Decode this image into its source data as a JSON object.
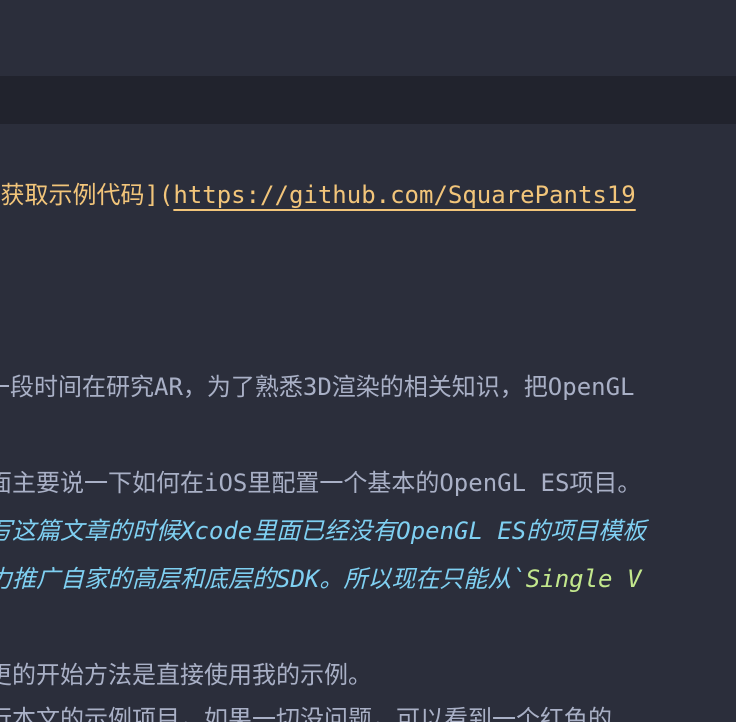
{
  "lines": {
    "link_line": {
      "text": "[获取示例代码](",
      "url": "https://github.com/SquarePants19"
    },
    "para1": "一段时间在研究AR，为了熟悉3D渲染的相关知识，把OpenGL",
    "para2": "面主要说一下如何在iOS里配置一个基本的OpenGL ES项目。",
    "note1": "写这篇文章的时候Xcode里面已经没有OpenGL ES的项目模板",
    "note2_prefix": "力推广自家的高层和底层的SDK。所以现在只能从`",
    "note2_code": "Single V",
    "para3": "更的开始方法是直接使用我的示例。",
    "para4": "行本文的示例项目，如果一切没问题，可以看到一个红色的"
  },
  "colors": {
    "background": "#2b2e3b",
    "band": "#21232d",
    "text": "#a9b0c6",
    "link": "#f2c57a",
    "note": "#7fd0f2",
    "code": "#c3e88d"
  }
}
